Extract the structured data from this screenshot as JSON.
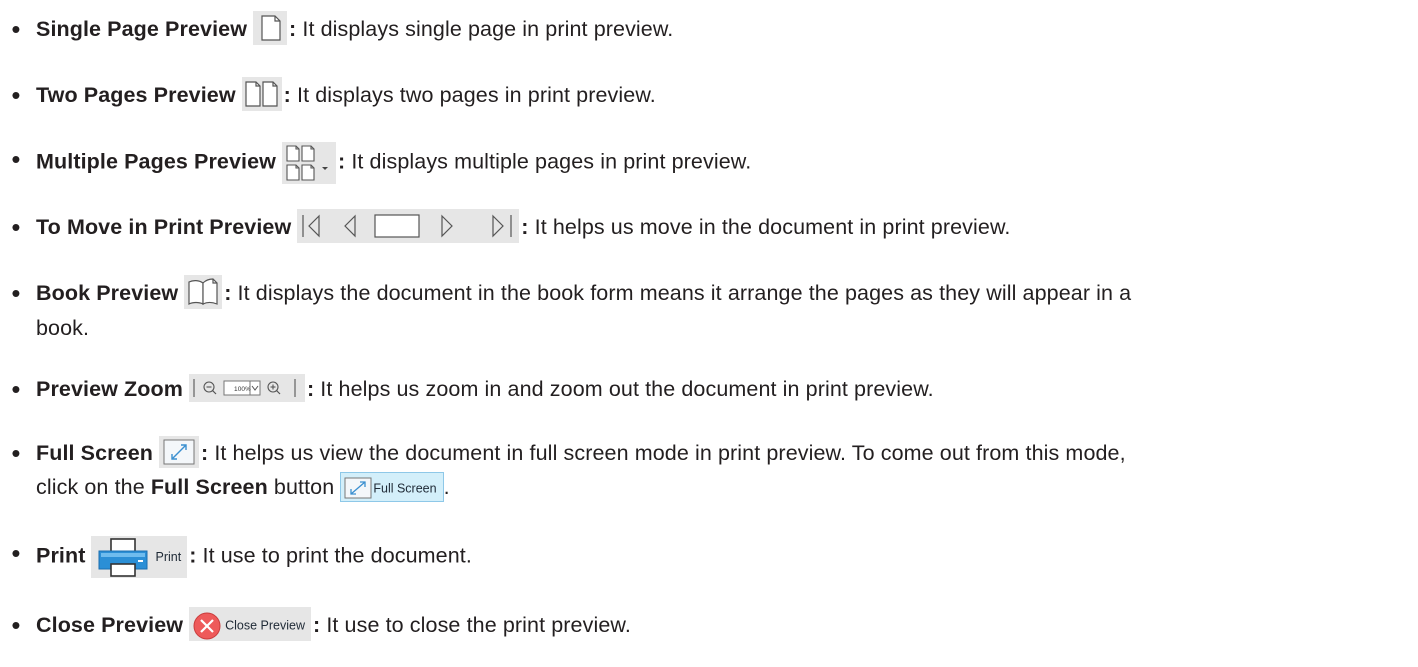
{
  "items": [
    {
      "title": "Single Page Preview",
      "icon": "single-page-icon",
      "sep": ":",
      "desc": " It displays single page in print preview."
    },
    {
      "title": "Two Pages Preview",
      "icon": "two-pages-icon",
      "sep": ":",
      "desc": " It displays two pages in print preview."
    },
    {
      "title": "Multiple Pages Preview",
      "icon": "multiple-pages-icon",
      "sep": ":",
      "desc": " It displays multiple pages in print preview."
    },
    {
      "title": "To Move in Print Preview",
      "icon": "navigation-icons",
      "sep": ":",
      "desc": " It helps us move in the document in print preview."
    },
    {
      "title": "Book Preview",
      "icon": "book-preview-icon",
      "sep": ":",
      "desc_line1": " It displays the document in the book form means it arrange the pages as they will appear in a",
      "desc_line2": "book."
    },
    {
      "title": "Preview Zoom",
      "icon": "zoom-icons",
      "zoom_value": "100%",
      "sep": ":",
      "desc": " It helps us zoom in and zoom out the document in print preview."
    },
    {
      "title": "Full Screen",
      "icon": "full-screen-icon",
      "sep": ":",
      "desc_line1": " It helps us view the document in full screen mode in print preview. To come out from this mode,",
      "desc_line2_a": "click on the ",
      "desc_line2_bold": "Full Screen",
      "desc_line2_b": " button ",
      "button_label": "Full Screen",
      "desc_line2_end": "."
    },
    {
      "title": "Print",
      "icon": "printer-icon",
      "button_label": "Print",
      "sep": ":",
      "desc": " It use to print the document."
    },
    {
      "title": "Close Preview",
      "icon": "close-icon",
      "button_label": "Close Preview",
      "sep": ":",
      "desc": " It use to close the print preview."
    }
  ],
  "colors": {
    "icon_bg": "#e6e6e6",
    "highlight_bg": "#d3effa",
    "highlight_border": "#8ec8e8",
    "close_red": "#ee5a5a",
    "text": "#231f20"
  }
}
